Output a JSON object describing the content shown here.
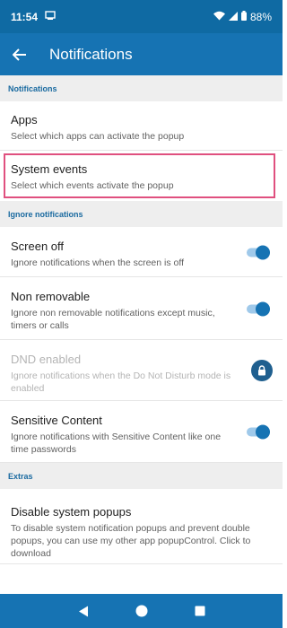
{
  "status_bar": {
    "time": "11:54",
    "battery": "88%"
  },
  "app_bar": {
    "title": "Notifications",
    "back_icon": "arrow-left-icon"
  },
  "sections": {
    "notifications": {
      "header": "Notifications",
      "apps": {
        "title": "Apps",
        "subtitle": "Select which apps can activate the popup"
      },
      "system_events": {
        "title": "System events",
        "subtitle": "Select which events activate the popup"
      }
    },
    "ignore": {
      "header": "Ignore notifications",
      "screen_off": {
        "title": "Screen off",
        "subtitle": "Ignore notifications when the screen is off",
        "enabled": true
      },
      "non_removable": {
        "title": "Non removable",
        "subtitle": "Ignore non removable notifications except music, timers or calls",
        "enabled": true
      },
      "dnd": {
        "title": "DND enabled",
        "subtitle": "Ignore notifications when the Do Not Disturb mode is enabled",
        "locked": true
      },
      "sensitive": {
        "title": "Sensitive Content",
        "subtitle": "Ignore notifications with Sensitive Content like one time passwords",
        "enabled": true
      }
    },
    "extras": {
      "header": "Extras",
      "disable_popups": {
        "title": "Disable system popups",
        "subtitle": "To disable system notification popups and prevent double popups, you can use my other app popupControl. Click to download"
      }
    }
  },
  "colors": {
    "primary": "#1673b3",
    "status": "#0f6aa3",
    "accent_track": "#9fc9ea",
    "highlight": "#e0507f",
    "section_text": "#1a6aa0"
  }
}
